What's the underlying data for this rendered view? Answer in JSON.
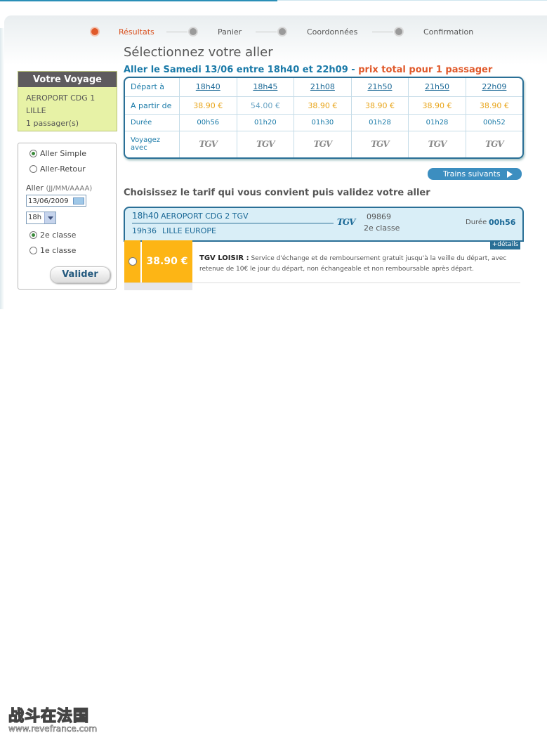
{
  "steps": [
    {
      "label": "Résultats",
      "active": true
    },
    {
      "label": "Panier",
      "active": false
    },
    {
      "label": "Coordonnées",
      "active": false
    },
    {
      "label": "Confirmation",
      "active": false
    }
  ],
  "page_title": "Sélectionnez votre aller",
  "subtitle": {
    "main": "Aller le Samedi 13/06 entre 18h40 et 22h09 - ",
    "orange": "prix total pour 1 passager"
  },
  "sidebar": {
    "voyage": {
      "title": "Votre Voyage",
      "from": "AEROPORT CDG 1",
      "to": "LILLE",
      "passengers": "1 passager(s)"
    },
    "form": {
      "aller_simple": "Aller Simple",
      "aller_retour": "Aller-Retour",
      "aller_label": "Aller",
      "date_format": "(JJ/MM/AAAA)",
      "date_value": "13/06/2009",
      "hour_value": "18h",
      "class2": "2e classe",
      "class1": "1e classe",
      "submit": "Valider"
    }
  },
  "times_table": {
    "row_labels": {
      "depart": "Départ à",
      "price": "A partir de",
      "duration": "Durée",
      "with": "Voyagez avec"
    },
    "columns": [
      {
        "depart": "18h40",
        "price": "38.90 €",
        "duration": "00h56",
        "logo": "TGV"
      },
      {
        "depart": "18h45",
        "price": "54.00 €",
        "duration": "01h20",
        "logo": "TGV"
      },
      {
        "depart": "21h08",
        "price": "38.90 €",
        "duration": "01h30",
        "logo": "TGV"
      },
      {
        "depart": "21h50",
        "price": "38.90 €",
        "duration": "01h28",
        "logo": "TGV"
      },
      {
        "depart": "21h50",
        "price": "38.90 €",
        "duration": "01h28",
        "logo": "TGV"
      },
      {
        "depart": "22h09",
        "price": "38.90 €",
        "duration": "00h52",
        "logo": "TGV"
      }
    ]
  },
  "trains_suivants": "Trains suivants",
  "choose_text": "Choisissez le tarif qui vous convient puis validez votre aller",
  "trip": {
    "dep_time": "18h40",
    "dep_station": "AEROPORT CDG 2 TGV",
    "arr_time": "19h36",
    "arr_station": "LILLE EUROPE",
    "logo": "TGV",
    "train_number": "09869",
    "class": "2e classe",
    "duration_label": "Durée",
    "duration": "00h56",
    "details": "+détails"
  },
  "fare": {
    "price": "38.90 €",
    "name": "TGV LOISIR :",
    "description": "Service d'échange et de remboursement gratuit jusqu'à la veille du départ, avec retenue de 10€ le jour du départ, non échangeable et non remboursable après départ."
  },
  "watermark": {
    "chinese": "战斗在法国",
    "url": "www.revefrance.com"
  },
  "colors": {
    "accent_blue": "#1a7aa8",
    "orange": "#e0592a",
    "fare_yellow": "#fdb515"
  }
}
